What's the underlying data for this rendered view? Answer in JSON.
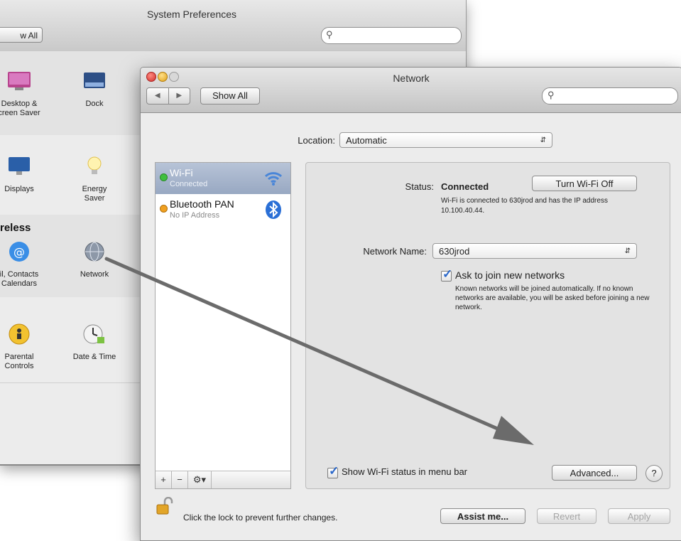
{
  "system_prefs": {
    "title": "System Preferences",
    "show_all": "w All",
    "search_placeholder": "",
    "items": [
      {
        "label": "Desktop &\ncreen Saver",
        "icon": "desktop-icon"
      },
      {
        "label": "Dock",
        "icon": "dock-icon"
      },
      {
        "label": "Displays",
        "icon": "display-icon"
      },
      {
        "label": "Energy\nSaver",
        "icon": "lightbulb-icon"
      },
      {
        "label": "il, Contacts\n Calendars",
        "icon": "at-sign-icon"
      },
      {
        "label": "Network",
        "icon": "network-globe-icon"
      },
      {
        "label": "Parental\nControls",
        "icon": "parental-controls-icon"
      },
      {
        "label": "Date & Time",
        "icon": "clock-icon"
      }
    ],
    "section_wireless": "reless"
  },
  "network": {
    "title": "Network",
    "show_all": "Show All",
    "search_placeholder": "",
    "location_label": "Location:",
    "location_value": "Automatic",
    "services": [
      {
        "name": "Wi-Fi",
        "status": "Connected",
        "dot_color": "#3fbf3f",
        "icon": "wifi-icon",
        "selected": true
      },
      {
        "name": "Bluetooth PAN",
        "status": "No IP Address",
        "dot_color": "#f0a020",
        "icon": "bluetooth-icon",
        "selected": false
      }
    ],
    "list_controls": {
      "add": "+",
      "remove": "−",
      "gear": "⚙▾"
    },
    "status_label": "Status:",
    "status_value": "Connected",
    "turn_off_button": "Turn Wi-Fi Off",
    "status_description": "Wi-Fi is connected to 630jrod and has the IP address 10.100.40.44.",
    "network_name_label": "Network Name:",
    "network_name_value": "630jrod",
    "ask_join_label": "Ask to join new networks",
    "ask_join_checked": true,
    "ask_join_description": "Known networks will be joined automatically. If no known networks are available, you will be asked before joining a new network.",
    "show_status_label": "Show Wi-Fi status in menu bar",
    "show_status_checked": true,
    "advanced_button": "Advanced...",
    "help_button": "?",
    "lock_text": "Click the lock to prevent further changes.",
    "assist_button": "Assist me...",
    "revert_button": "Revert",
    "apply_button": "Apply"
  },
  "colors": {
    "accent_blue": "#2a67c9",
    "selection": "#a8b6ce",
    "arrow": "#666666"
  }
}
